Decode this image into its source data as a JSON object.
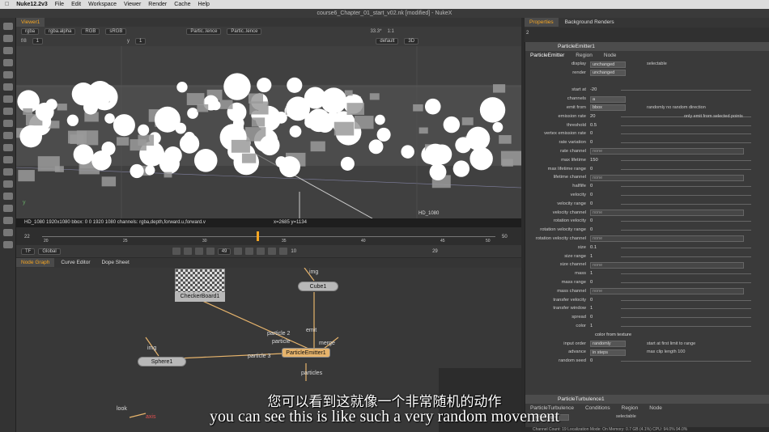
{
  "menubar": {
    "app": "Nuke12.2v3",
    "items": [
      "File",
      "Edit",
      "Workspace",
      "Viewer",
      "Render",
      "Cache",
      "Help"
    ]
  },
  "window_title": "course6_Chapter_01_start_v02.nk [modified] - NukeX",
  "viewer": {
    "tab": "Viewer1",
    "channels": "rgba",
    "alpha": "rgba.alpha",
    "colorspace_in": "RGB",
    "lut": "sRGB",
    "input_a": "Partic..lence",
    "input_b": "Partic..lence",
    "frame_label": "f/8",
    "frame_val": "1",
    "y_label": "y",
    "y_val": "1",
    "zoom": "33.3*",
    "ratio": "1:1",
    "view3d": "3D",
    "cam": "default",
    "info": "HD_1080 1920x1080  bbox: 0 0 1920 1080 channels: rgba,depth,forward.u,forward.v",
    "coords": "x=2685 y=1134",
    "format_label": "HD_1080"
  },
  "timeline": {
    "start": "22",
    "end": "50",
    "ticks": [
      "20",
      "25",
      "30",
      "35",
      "40",
      "45",
      "50"
    ],
    "current": "49",
    "tf": "TF",
    "scope": "Global",
    "step": "10",
    "fps": "29"
  },
  "nodegraph": {
    "tabs": [
      "Node Graph",
      "Curve Editor",
      "Dope Sheet"
    ],
    "nodes": {
      "checkerboard": "CheckerBoard1",
      "cube": "Cube1",
      "sphere": "Sphere1",
      "emitter": "ParticleEmitter1"
    },
    "labels": {
      "img1": "img",
      "img2": "img",
      "img3": "img",
      "particle2": "particle 2",
      "particle": "particle",
      "particle3": "particle 3",
      "emit": "emit",
      "merge": "merge",
      "particles": "particles",
      "look": "look",
      "axis": "axis"
    }
  },
  "properties": {
    "tabs": [
      "Properties",
      "Background Renders"
    ],
    "count": "2",
    "node_title": "ParticleEmitter1",
    "subtabs": [
      "ParticleEmitter",
      "Region",
      "Node"
    ],
    "rows": [
      {
        "label": "display",
        "kind": "dd",
        "value": "unchanged",
        "extra": "selectable"
      },
      {
        "label": "render",
        "kind": "dd",
        "value": "unchanged"
      },
      {
        "label": "",
        "kind": "gap"
      },
      {
        "label": "start at",
        "kind": "slider",
        "value": "-20"
      },
      {
        "label": "channels",
        "kind": "dd",
        "value": "a"
      },
      {
        "label": "emit from",
        "kind": "dd",
        "value": "bbox",
        "extra": "randomly   no random direction"
      },
      {
        "label": "emission rate",
        "kind": "slider",
        "value": "20",
        "extra": "only emit from selected points"
      },
      {
        "label": "threshold",
        "kind": "slider",
        "value": "0.5"
      },
      {
        "label": "vertex emission rate",
        "kind": "slider",
        "value": "0"
      },
      {
        "label": "rate variation",
        "kind": "slider",
        "value": "0"
      },
      {
        "label": "rate channel",
        "kind": "wide",
        "value": "none"
      },
      {
        "label": "max lifetime",
        "kind": "slider",
        "value": "150"
      },
      {
        "label": "max lifetime range",
        "kind": "slider",
        "value": "0"
      },
      {
        "label": "lifetime channel",
        "kind": "wide",
        "value": "none"
      },
      {
        "label": "halflife",
        "kind": "slider",
        "value": "0"
      },
      {
        "label": "velocity",
        "kind": "slider",
        "value": "0"
      },
      {
        "label": "velocity range",
        "kind": "slider",
        "value": "0"
      },
      {
        "label": "velocity channel",
        "kind": "wide",
        "value": "none"
      },
      {
        "label": "rotation velocity",
        "kind": "slider",
        "value": "0"
      },
      {
        "label": "rotation velocity range",
        "kind": "slider",
        "value": "0"
      },
      {
        "label": "rotation velocity channel",
        "kind": "wide",
        "value": "none"
      },
      {
        "label": "size",
        "kind": "slider",
        "value": "0.1"
      },
      {
        "label": "size range",
        "kind": "slider",
        "value": "1"
      },
      {
        "label": "size channel",
        "kind": "wide",
        "value": "none"
      },
      {
        "label": "mass",
        "kind": "slider",
        "value": "1"
      },
      {
        "label": "mass range",
        "kind": "slider",
        "value": "0"
      },
      {
        "label": "mass channel",
        "kind": "wide",
        "value": "none"
      },
      {
        "label": "transfer velocity",
        "kind": "slider",
        "value": "0"
      },
      {
        "label": "transfer window",
        "kind": "slider",
        "value": "1"
      },
      {
        "label": "spread",
        "kind": "slider",
        "value": "0"
      },
      {
        "label": "color",
        "kind": "slider",
        "value": "1"
      },
      {
        "label": "",
        "kind": "check",
        "value": "color from texture"
      },
      {
        "label": "input order",
        "kind": "dd",
        "value": "randomly",
        "extra": "start at  first        limit to range"
      },
      {
        "label": "advance",
        "kind": "dd",
        "value": "in steps",
        "extra": "max clip length  100"
      },
      {
        "label": "random seed",
        "kind": "slider",
        "value": "0"
      }
    ],
    "second_node": "ParticleTurbulence1",
    "second_subtabs": [
      "ParticleTurbulence",
      "Conditions",
      "Region",
      "Node"
    ],
    "second_display": "unchanged",
    "second_selectable": "selectable",
    "status": "Channel Count: 19  Localization Mode: On  Memory: 0.7 GB (4.1%)  CPU: 94.0%  94.0%"
  },
  "subtitles": {
    "cn": "您可以看到这就像一个非常随机的动作",
    "en": "you can see this is like such a very random movement"
  }
}
